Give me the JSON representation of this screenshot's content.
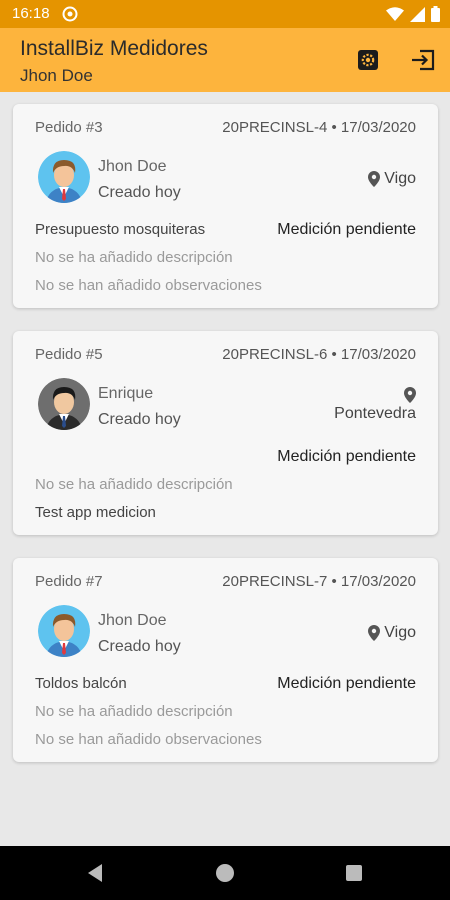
{
  "status_bar": {
    "time": "16:18"
  },
  "app_bar": {
    "title": "InstallBiz Medidores",
    "subtitle": "Jhon Doe",
    "icons": [
      "settings-icon",
      "logout-icon"
    ]
  },
  "orders": [
    {
      "order_number": "Pedido #3",
      "code_date": "20PRECINSL-4 • 17/03/2020",
      "user_name": "Jhon Doe",
      "created": "Creado hoy",
      "location": "Vigo",
      "job_title": "Presupuesto mosquiteras",
      "status": "Medición pendiente",
      "description": "No se ha añadido descripción",
      "observations": "No se han añadido observaciones"
    },
    {
      "order_number": "Pedido #5",
      "code_date": "20PRECINSL-6 • 17/03/2020",
      "user_name": "Enrique",
      "created": "Creado hoy",
      "location": "Pontevedra",
      "job_title": "",
      "status": "Medición pendiente",
      "description": "No se ha añadido descripción",
      "observations": "Test app medicion"
    },
    {
      "order_number": "Pedido #7",
      "code_date": "20PRECINSL-7 • 17/03/2020",
      "user_name": "Jhon Doe",
      "created": "Creado hoy",
      "location": "Vigo",
      "job_title": "Toldos balcón",
      "status": "Medición pendiente",
      "description": "No se ha añadido descripción",
      "observations": "No se han añadido observaciones"
    }
  ],
  "colors": {
    "status_bar": "#e59400",
    "app_bar": "#fdb43d",
    "background": "#e8e8e8",
    "card": "#f7f7f7"
  }
}
